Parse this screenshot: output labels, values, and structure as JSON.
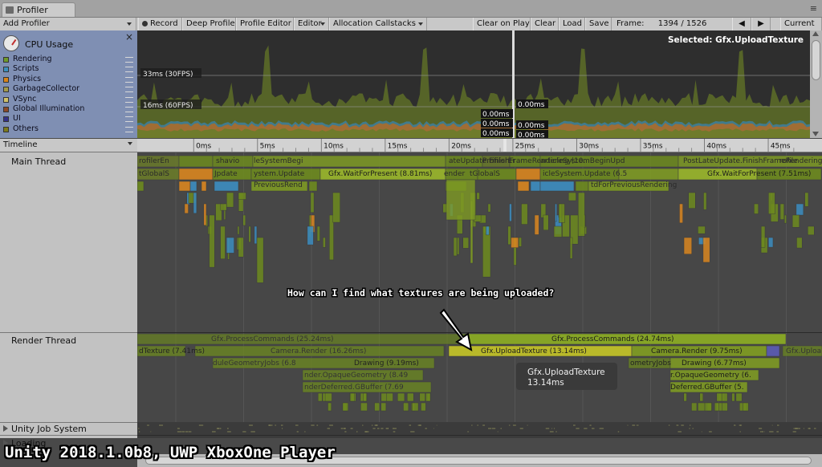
{
  "window": {
    "tab_title": "Profiler",
    "add_profiler": "Add Profiler"
  },
  "toolbar": {
    "buttons": [
      "Record",
      "Deep Profile",
      "Profile Editor",
      "Editor",
      "Allocation Callstacks",
      "Clear on Play",
      "Clear",
      "Load",
      "Save"
    ],
    "frame_label": "Frame:",
    "frame_value": "1394 / 1526",
    "current": "Current"
  },
  "cpu": {
    "title": "CPU Usage",
    "close": "×",
    "legend": [
      {
        "label": "Rendering",
        "color": "#6f9a2b"
      },
      {
        "label": "Scripts",
        "color": "#3d8fbd"
      },
      {
        "label": "Physics",
        "color": "#d8841a"
      },
      {
        "label": "GarbageCollector",
        "color": "#a39a4b"
      },
      {
        "label": "VSync",
        "color": "#cfc06a"
      },
      {
        "label": "Global Illumination",
        "color": "#8b4a2a"
      },
      {
        "label": "UI",
        "color": "#34318a"
      },
      {
        "label": "Others",
        "color": "#7c7a1d"
      }
    ],
    "selected_label": "Selected: Gfx.UploadTexture",
    "line_33": "33ms (30FPS)",
    "line_16": "16ms (60FPS)",
    "readouts": [
      "0.00ms",
      "0.00ms",
      "0.00ms",
      "0.00ms",
      "0.00ms",
      "0.00ms"
    ]
  },
  "timeline": {
    "dropdown": "Timeline",
    "ticks": [
      "0ms",
      "5ms",
      "10ms",
      "15ms",
      "20ms",
      "25ms",
      "30ms",
      "35ms",
      "40ms",
      "45ms"
    ],
    "groups": {
      "main": "Main Thread",
      "render": "Render Thread",
      "job": "Unity Job System",
      "loading": "Loading"
    },
    "main_labels": [
      "rofilerEn",
      "shavio",
      "leSystemBegi",
      "ateUpdate.FinishFrameRendering (10.",
      "ProfilerEr",
      "articleSystemBeginUpd",
      "PostLateUpdate.FinishFrameRendering",
      "rofile",
      "tGlobalS",
      "Jpdate",
      "ystem.Update",
      "Gfx.WaitForPresent (8.81ms)",
      "ender",
      "tGlobalS",
      "icleSystem.Update (6.5",
      "Gfx.WaitForPresent (7.51ms)",
      "PreviousRend",
      "tdForPreviousRendering"
    ],
    "render_labels": [
      "Gfx.ProcessCommands (25.24ms)",
      "Gfx.ProcessCommands (24.74ms)",
      "dTexture (7.41ms)",
      "Camera.Render (16.26ms)",
      "Gfx.UploadTexture (13.14ms)",
      "Camera.Render (9.75ms)",
      "Gfx.Uploa",
      "duleGeometryJobs (6.8",
      "Drawing (9.19ms)",
      "ometryJobs",
      "Drawing (6.77ms)",
      "nder.OpaqueGeometry (8.49",
      "r.OpaqueGeometry (6.",
      "nderDeferred.GBuffer (7.69",
      "Deferred.GBuffer (5."
    ],
    "tooltip": {
      "name": "Gfx.UploadTexture",
      "time": "13.14ms"
    },
    "annotation": "How can I find what textures are being uploaded?"
  },
  "caption": "Unity 2018.1.0b8, UWP XboxOne Player"
}
